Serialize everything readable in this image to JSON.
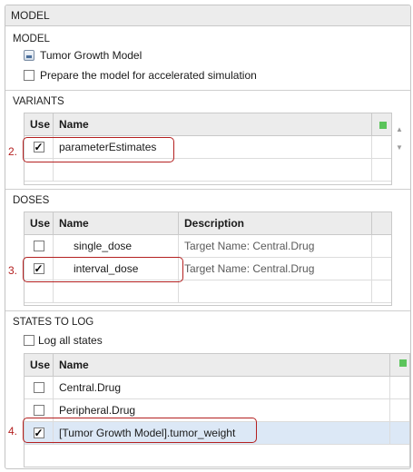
{
  "panel": {
    "header": "MODEL"
  },
  "model_section": {
    "title": "MODEL",
    "model_name": "Tumor Growth Model",
    "model_icon": "model-icon",
    "accelerate_label": "Prepare the model for accelerated simulation",
    "accelerate_checked": false
  },
  "variants": {
    "title": "VARIANTS",
    "columns": [
      "Use",
      "Name"
    ],
    "rows": [
      {
        "use": true,
        "name": "parameterEstimates"
      }
    ],
    "marker": "2."
  },
  "doses": {
    "title": "DOSES",
    "columns": [
      "Use",
      "Name",
      "Description"
    ],
    "rows": [
      {
        "use": false,
        "name": "single_dose",
        "description": "Target Name: Central.Drug"
      },
      {
        "use": true,
        "name": "interval_dose",
        "description": "Target Name: Central.Drug"
      }
    ],
    "marker": "3."
  },
  "states": {
    "title": "STATES TO LOG",
    "log_all_label": "Log all states",
    "log_all_checked": false,
    "columns": [
      "Use",
      "Name"
    ],
    "rows": [
      {
        "use": false,
        "name": "Central.Drug"
      },
      {
        "use": false,
        "name": "Peripheral.Drug"
      },
      {
        "use": true,
        "name": "[Tumor Growth Model].tumor_weight"
      }
    ],
    "marker": "4."
  },
  "colors": {
    "accent_status": "#5bc45b",
    "highlight": "#b42020",
    "selected_row": "#dce8f6"
  }
}
